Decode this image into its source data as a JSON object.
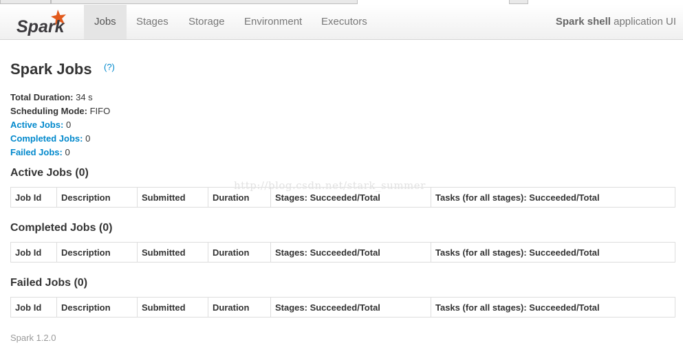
{
  "navbar": {
    "brand": "Spark",
    "tabs": [
      {
        "label": "Jobs",
        "active": true
      },
      {
        "label": "Stages",
        "active": false
      },
      {
        "label": "Storage",
        "active": false
      },
      {
        "label": "Environment",
        "active": false
      },
      {
        "label": "Executors",
        "active": false
      }
    ],
    "app_name": "Spark shell",
    "app_suffix": "application UI"
  },
  "page": {
    "title": "Spark Jobs",
    "help": "(?)"
  },
  "summary": {
    "total_duration_label": "Total Duration:",
    "total_duration_value": "34 s",
    "scheduling_mode_label": "Scheduling Mode:",
    "scheduling_mode_value": "FIFO",
    "active_jobs_label": "Active Jobs:",
    "active_jobs_value": "0",
    "completed_jobs_label": "Completed Jobs:",
    "completed_jobs_value": "0",
    "failed_jobs_label": "Failed Jobs:",
    "failed_jobs_value": "0"
  },
  "columns": [
    "Job Id",
    "Description",
    "Submitted",
    "Duration",
    "Stages: Succeeded/Total",
    "Tasks (for all stages): Succeeded/Total"
  ],
  "sections": {
    "active": "Active Jobs (0)",
    "completed": "Completed Jobs (0)",
    "failed": "Failed Jobs (0)"
  },
  "footer": "Spark 1.2.0",
  "watermark": "http://blog.csdn.net/stark_summer",
  "colors": {
    "link": "#0088cc",
    "brand_orange": "#e25a1c",
    "brand_text": "#3c3a3e"
  }
}
